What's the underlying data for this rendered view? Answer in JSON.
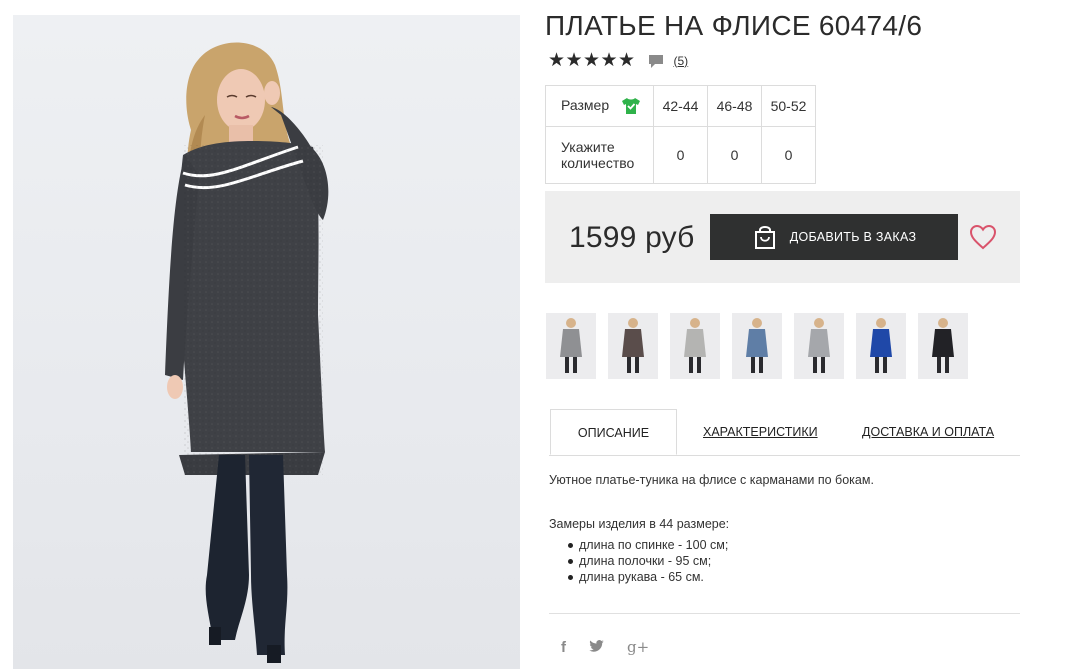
{
  "product": {
    "title": "ПЛАТЬЕ НА ФЛИСЕ 60474/6",
    "rating_stars": 5,
    "review_count": "(5)"
  },
  "sizes": {
    "size_label": "Размер",
    "qty_label": "Укажите количество",
    "options": [
      "42-44",
      "46-48",
      "50-52"
    ],
    "quantities": [
      "0",
      "0",
      "0"
    ]
  },
  "buy": {
    "price": "1599 руб",
    "add_label": "ДОБАВИТЬ В ЗАКАЗ"
  },
  "tabs": {
    "description": "ОПИСАНИЕ",
    "specs": "ХАРАКТЕРИСТИКИ",
    "delivery": "ДОСТАВКА И ОПЛАТА"
  },
  "description": {
    "text": "Уютное платье-туника на флисе с карманами по бокам.",
    "measure_title": "Замеры изделия в 44 размере:",
    "measures": [
      "длина по спинке - 100 см;",
      "длина полочки - 95 см;",
      "длина рукава - 65 см."
    ]
  },
  "social": {
    "facebook": "f",
    "twitter": "t",
    "google": "g+"
  },
  "colors": {
    "accent_button": "#2f3030",
    "heart": "#d9536b",
    "tshirt_icon": "#2fb24a",
    "buybox_bg": "#eeeeee"
  },
  "thumbnails": [
    {
      "color": "#8f9093"
    },
    {
      "color": "#5a4d4b"
    },
    {
      "color": "#b4b4b2"
    },
    {
      "color": "#5f7ea6"
    },
    {
      "color": "#a5a7ab"
    },
    {
      "color": "#1f48a8"
    },
    {
      "color": "#222226"
    }
  ]
}
